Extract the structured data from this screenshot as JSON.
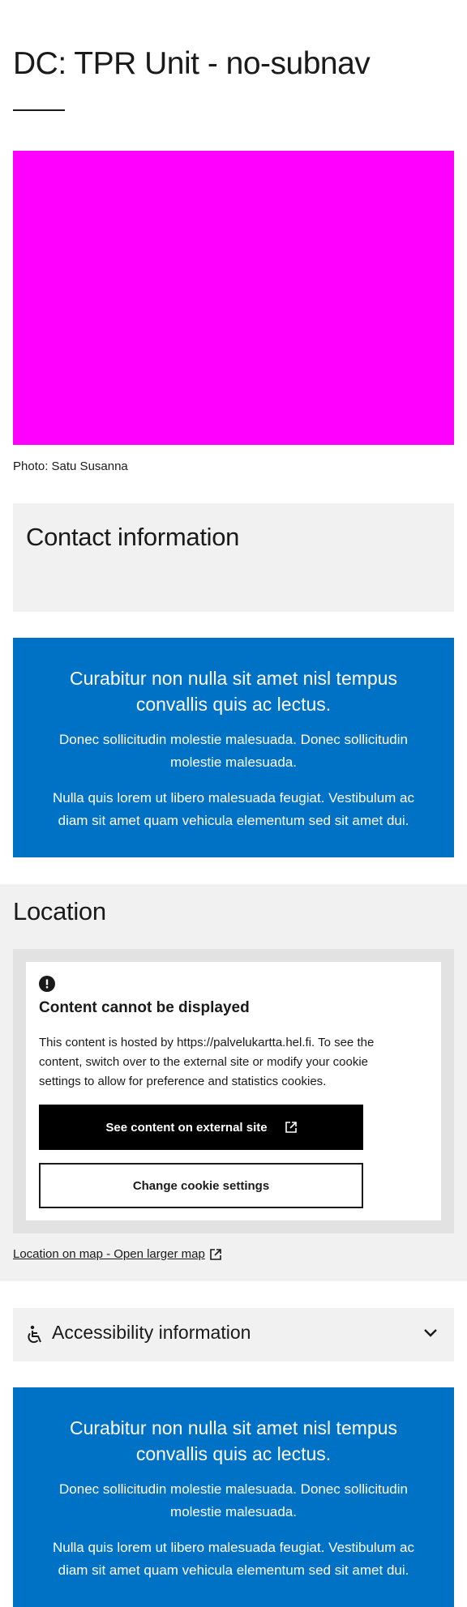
{
  "page": {
    "title": "DC: TPR Unit - no-subnav"
  },
  "hero": {
    "image_color": "#ff00ff",
    "caption": "Photo: Satu Susanna"
  },
  "contact": {
    "title": "Contact information"
  },
  "banner_top": {
    "title": "Curabitur non nulla sit amet nisl tempus convallis quis ac lectus.",
    "paragraph_1": "Donec sollicitudin molestie malesuada. Donec sollicitudin molestie malesuada.",
    "paragraph_2": "Nulla quis lorem ut libero malesuada feugiat. Vestibulum ac diam sit amet quam vehicula elementum sed sit amet dui."
  },
  "location": {
    "title": "Location",
    "notice": {
      "icon": "alert-circle-icon",
      "title": "Content cannot be displayed",
      "text": "This content is hosted by https://palvelukartta.hel.fi. To see the content, switch over to the external site or modify your cookie settings to allow for preference and statistics cookies.",
      "external_button": "See content on external site",
      "cookie_button": "Change cookie settings"
    },
    "map_link": "Location on map - Open larger map"
  },
  "accessibility": {
    "icon": "wheelchair-icon",
    "title": "Accessibility information",
    "toggle_icon": "chevron-down-icon"
  },
  "banner_bottom": {
    "title": "Curabitur non nulla sit amet nisl tempus convallis quis ac lectus.",
    "paragraph_1": "Donec sollicitudin molestie malesuada. Donec sollicitudin molestie malesuada.",
    "paragraph_2": "Nulla quis lorem ut libero malesuada feugiat. Vestibulum ac diam sit amet quam vehicula elementum sed sit amet dui."
  },
  "colors": {
    "banner": "#0072c6",
    "section_grey": "#f1f1f1",
    "map_frame": "#e2e2e2",
    "primary_button": "#000000"
  }
}
